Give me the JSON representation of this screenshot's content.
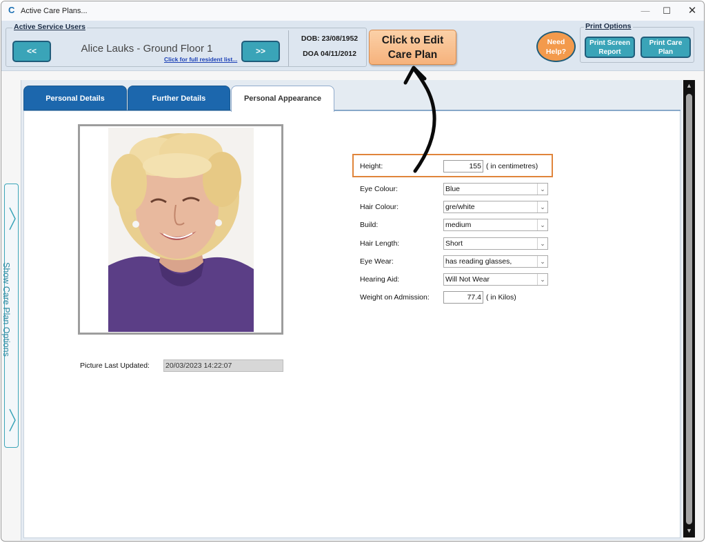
{
  "window": {
    "title": "Active Care Plans...",
    "minimize": "—",
    "maximize": "☐",
    "close": "✕"
  },
  "header": {
    "service_users_title": "Active Service Users",
    "prev_label": "<<",
    "next_label": ">>",
    "resident_name": "Alice Lauks - Ground Floor 1",
    "resident_list_link": "Click for full resident list...",
    "dob": "DOB: 23/08/1952",
    "doa": "DOA 04/11/2012",
    "edit_label_line1": "Click to Edit",
    "edit_label_line2": "Care Plan",
    "help_line1": "Need",
    "help_line2": "Help?",
    "print_title": "Print Options",
    "print_screen_line1": "Print Screen",
    "print_screen_line2": "Report",
    "print_plan_line1": "Print Care",
    "print_plan_line2": "Plan"
  },
  "tabs": [
    {
      "label": "Personal Details"
    },
    {
      "label": "Further Details"
    },
    {
      "label": "Personal Appearance"
    }
  ],
  "side_panel": {
    "label": "Show Care Plan Options"
  },
  "appearance": {
    "picture_label": "Picture Last Updated:",
    "picture_updated": "20/03/2023 14:22:07",
    "height_label": "Height:",
    "height_value": "155",
    "height_unit": "( in centimetres)",
    "eye_colour_label": "Eye Colour:",
    "eye_colour": "Blue",
    "hair_colour_label": "Hair Colour:",
    "hair_colour": "gre/white",
    "build_label": "Build:",
    "build": "medium",
    "hair_length_label": "Hair Length:",
    "hair_length": "Short",
    "eye_wear_label": "Eye Wear:",
    "eye_wear": "has reading glasses,",
    "hearing_aid_label": "Hearing Aid:",
    "hearing_aid": "Will Not Wear",
    "weight_label": "Weight on Admission:",
    "weight_value": "77.4",
    "weight_unit": "( in Kilos)"
  },
  "colors": {
    "accent_teal": "#3aa4b8",
    "tab_blue": "#1c67ad",
    "edit_orange": "#f6b27c",
    "highlight_orange": "#e0843a"
  }
}
